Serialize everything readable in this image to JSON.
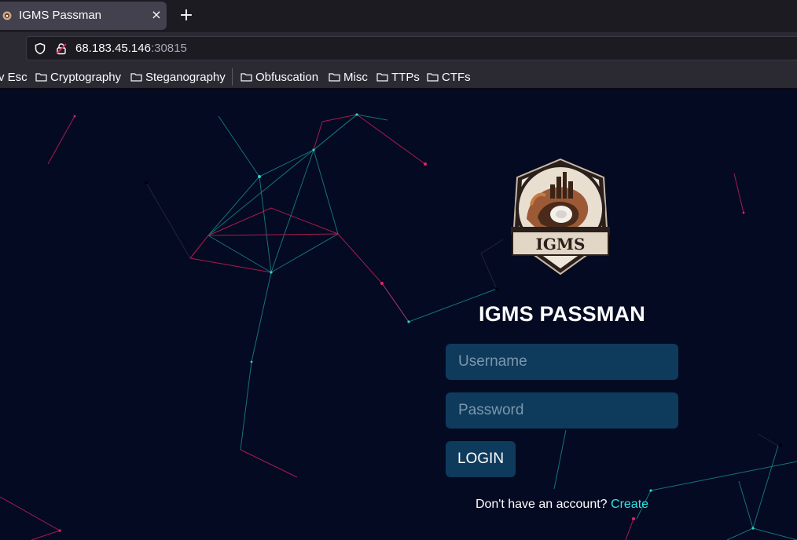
{
  "browser": {
    "tab": {
      "title": "IGMS Passman",
      "close_glyph": "×",
      "icon": "app-favicon"
    },
    "new_tab_glyph": "+",
    "url": {
      "host": "68.183.45.146",
      "port": ":30815"
    },
    "bookmarks": [
      {
        "label": "v Esc",
        "folder": false
      },
      {
        "label": "Cryptography",
        "folder": true
      },
      {
        "label": "Steganography",
        "folder": true
      },
      {
        "label": "Obfuscation",
        "folder": true
      },
      {
        "label": "Misc",
        "folder": true
      },
      {
        "label": "TTPs",
        "folder": true
      },
      {
        "label": "CTFs",
        "folder": true
      }
    ]
  },
  "login": {
    "logo_text": "IGMS",
    "title": "IGMS PASSMAN",
    "username_placeholder": "Username",
    "password_placeholder": "Password",
    "login_label": "LOGIN",
    "signup_prompt": "Don't have an account?",
    "signup_link": "Create"
  },
  "colors": {
    "page_background": "#040a22",
    "field_background": "#0e3a5c",
    "link": "#2ee6e6",
    "network_teal": "#1fb5b0",
    "network_pink": "#d0215a"
  }
}
